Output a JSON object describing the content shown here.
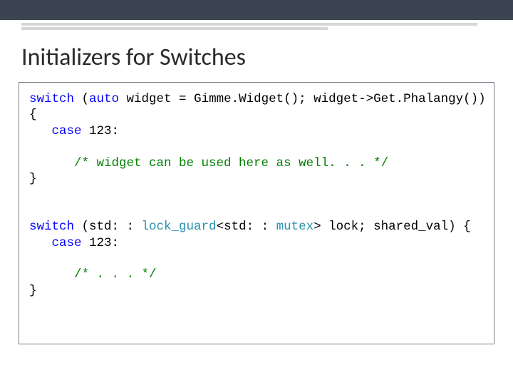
{
  "title": "Initializers for Switches",
  "code": {
    "l1a": "switch",
    "l1b": " (",
    "l1c": "auto",
    "l1d": " widget = Gimme.Widget(); widget->Get.Phalangy())",
    "l2": "{",
    "l3a": "   ",
    "l3b": "case",
    "l3c": " 123:",
    "l5a": "      ",
    "l5b": "/* widget can be used here as well. . . */",
    "l6": "}",
    "l9a": "switch",
    "l9b": " (std: : ",
    "l9c": "lock_guard",
    "l9d": "<std: : ",
    "l9e": "mutex",
    "l9f": "> lock; shared_val) {",
    "l10a": "   ",
    "l10b": "case",
    "l10c": " 123:",
    "l12a": "      ",
    "l12b": "/* . . . */",
    "l13": "}"
  }
}
